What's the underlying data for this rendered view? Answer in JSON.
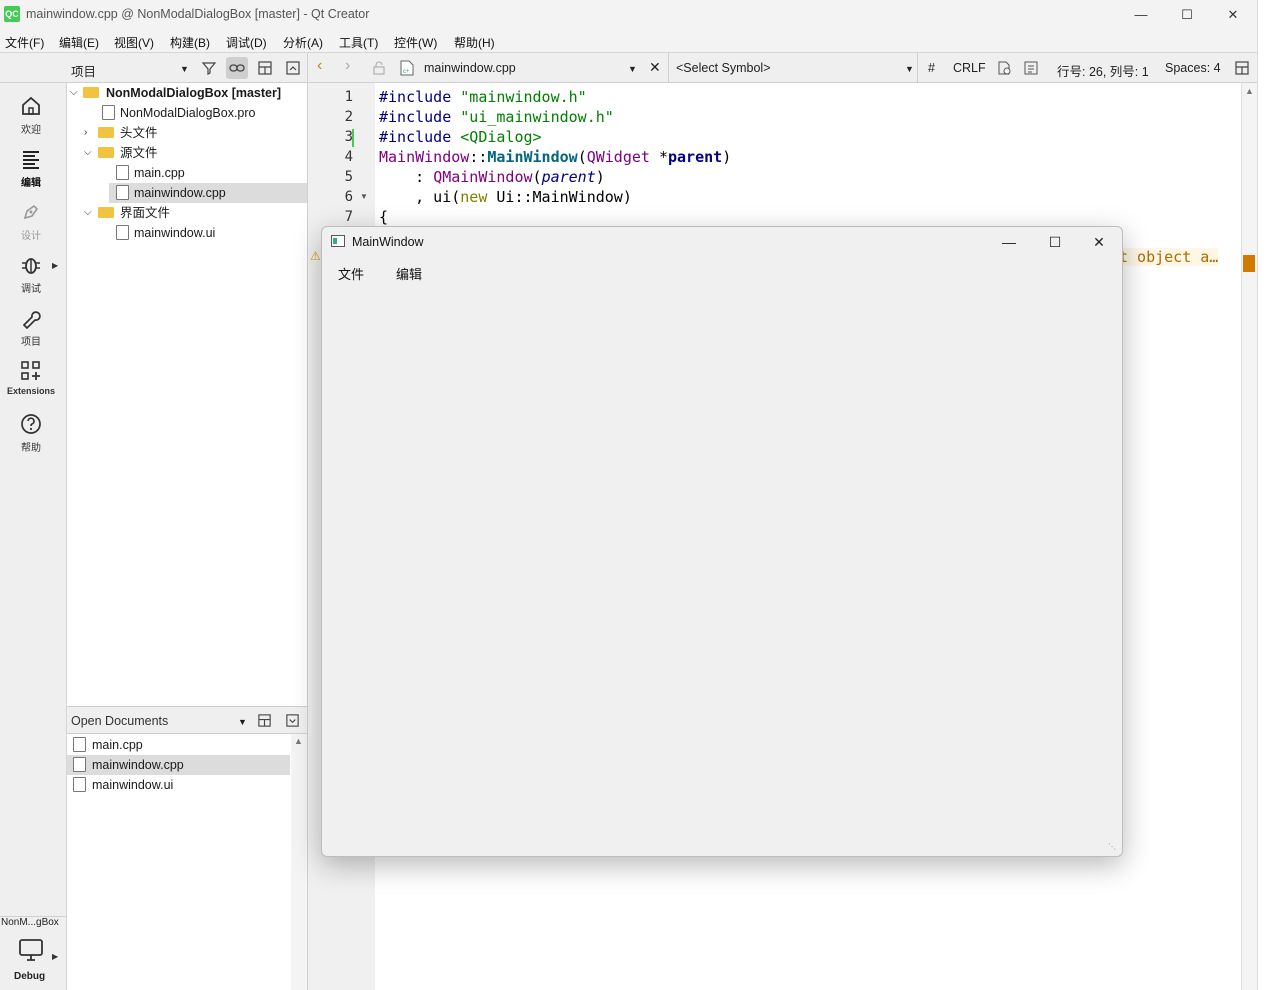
{
  "window": {
    "title": "mainwindow.cpp @ NonModalDialogBox [master] - Qt Creator",
    "app_badge": "QC"
  },
  "menu": [
    "文件(F)",
    "编辑(E)",
    "视图(V)",
    "构建(B)",
    "调试(D)",
    "分析(A)",
    "工具(T)",
    "控件(W)",
    "帮助(H)"
  ],
  "project_pane": {
    "selector": "项目",
    "tree": [
      {
        "label": "NonModalDialogBox [master]",
        "level": 0,
        "expanded": true,
        "bold": true
      },
      {
        "label": "NonModalDialogBox.pro",
        "level": 1
      },
      {
        "label": "头文件",
        "level": 1,
        "expanded": false
      },
      {
        "label": "源文件",
        "level": 1,
        "expanded": true
      },
      {
        "label": "main.cpp",
        "level": 2
      },
      {
        "label": "mainwindow.cpp",
        "level": 2,
        "selected": true
      },
      {
        "label": "界面文件",
        "level": 1,
        "expanded": true
      },
      {
        "label": "mainwindow.ui",
        "level": 2
      }
    ]
  },
  "open_documents": {
    "title": "Open Documents",
    "items": [
      {
        "label": "main.cpp"
      },
      {
        "label": "mainwindow.cpp",
        "selected": true
      },
      {
        "label": "mainwindow.ui"
      }
    ]
  },
  "modes": [
    {
      "label": "欢迎",
      "icon": "home-icon"
    },
    {
      "label": "编辑",
      "icon": "edit-icon",
      "active": true
    },
    {
      "label": "设计",
      "icon": "design-icon",
      "disabled": true
    },
    {
      "label": "调试",
      "icon": "debug-icon"
    },
    {
      "label": "项目",
      "icon": "wrench-icon"
    },
    {
      "label": "Extensions",
      "icon": "extensions-icon"
    },
    {
      "label": "帮助",
      "icon": "help-icon"
    }
  ],
  "kit_selector": {
    "project": "NonM...gBox",
    "config": "Debug"
  },
  "editor_toolbar": {
    "file": "mainwindow.cpp",
    "symbol": "<Select Symbol>",
    "hash": "#",
    "line_ending": "CRLF",
    "position": "行号: 26, 列号: 1",
    "indent": "Spaces: 4"
  },
  "editor": {
    "line_numbers": [
      "1",
      "2",
      "3",
      "4",
      "5",
      "6",
      "7"
    ],
    "code": {
      "l1_kw": "#include",
      "l1_str": "\"mainwindow.h\"",
      "l2_kw": "#include",
      "l2_str": "\"ui_mainwindow.h\"",
      "l3_kw": "#include",
      "l3_str": "<QDialog>",
      "l4_cls": "MainWindow",
      "l4_sep": "::",
      "l4_fn": "MainWindow",
      "l4_open": "(",
      "l4_type": "QWidget",
      "l4_star": " *",
      "l4_par": "parent",
      "l4_close": ")",
      "l5_pre": "    : ",
      "l5_type": "QMainWindow",
      "l5_open": "(",
      "l5_par": "parent",
      "l5_close": ")",
      "l6_pre": "    , ui(",
      "l6_kw": "new",
      "l6_mid": " Ui::MainWindow)",
      "l7": "{",
      "warning_tail": "t object a…"
    }
  },
  "dialog": {
    "title": "MainWindow",
    "menu": [
      "文件",
      "编辑"
    ]
  },
  "colors": {
    "accent_green": "#41cd52",
    "warning": "#d48a00",
    "selection": "#dcdcdc"
  }
}
